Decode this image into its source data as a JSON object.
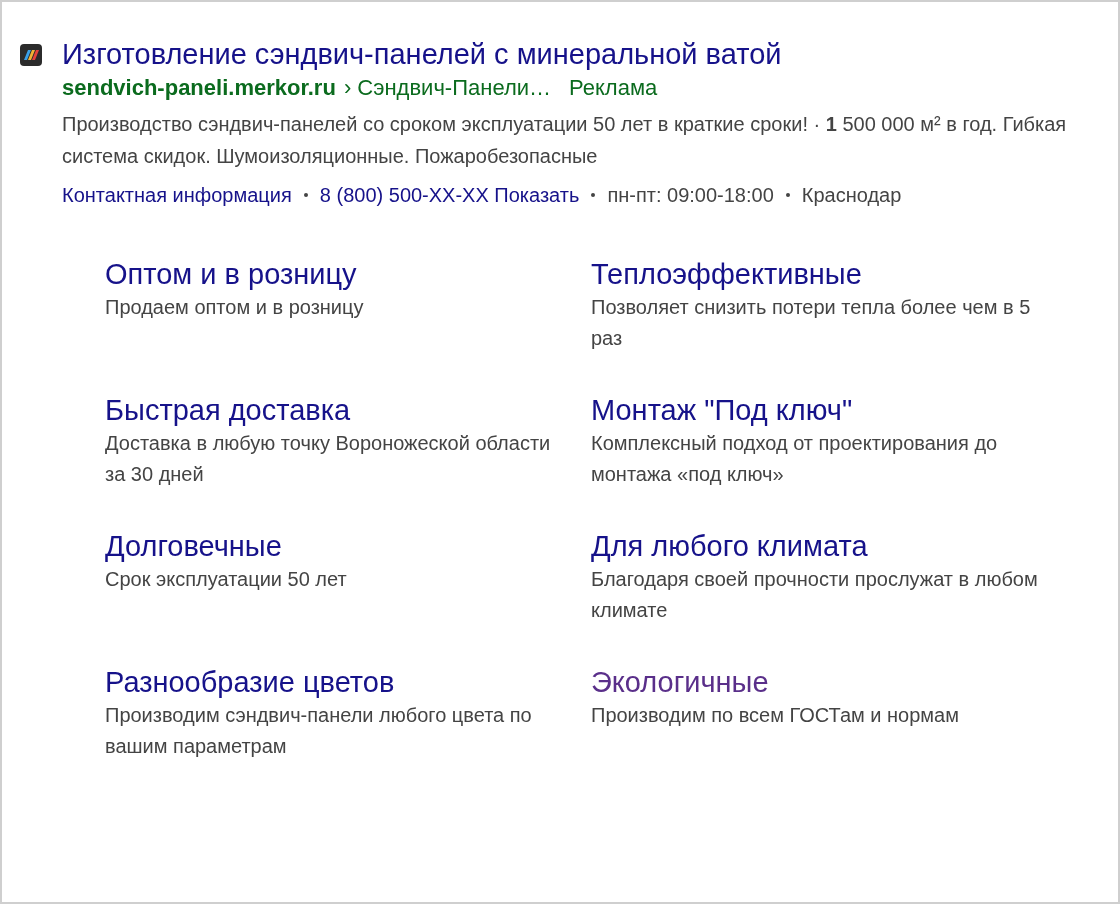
{
  "ad": {
    "title": "Изготовление сэндвич-панелей с минеральной ватой",
    "domain": "sendvich-paneli.merkor.ru",
    "path": "› Сэндвич-Панели…",
    "label": "Реклама",
    "description": "Производство сэндвич-панелей со сроком эксплуатации 50 лет в краткие сроки! · **1** 500 000 м² в год. Гибкая система скидок. Шумоизоляционные. Пожаробезопасные",
    "contacts": [
      {
        "kind": "link",
        "text": "Контактная информация"
      },
      {
        "kind": "link",
        "text": "8 (800) 500-XX-XX Показать"
      },
      {
        "kind": "text",
        "text": "пн-пт: 09:00-18:00"
      },
      {
        "kind": "text",
        "text": "Краснодар"
      }
    ]
  },
  "sitelinks": [
    {
      "title": "Оптом и в розницу",
      "text": "Продаем оптом и в розницу",
      "visited": false
    },
    {
      "title": "Теплоэффективные",
      "text": "Позволяет снизить потери тепла более чем в 5 раз",
      "visited": false
    },
    {
      "title": "Быстрая доставка",
      "text": "Доставка в любую точку Вороножеской области за 30 дней",
      "visited": false
    },
    {
      "title": "Монтаж \"Под ключ\"",
      "text": "Комплексный подход от проектирования до монтажа «под ключ»",
      "visited": false
    },
    {
      "title": "Долговечные",
      "text": "Срок эксплуатации 50 лет",
      "visited": false
    },
    {
      "title": "Для любого климата",
      "text": "Благодаря своей прочности прослужат в любом климате",
      "visited": false
    },
    {
      "title": "Разнообразие цветов",
      "text": "Производим сэндвич-панели любого цвета по вашим параметрам",
      "visited": false
    },
    {
      "title": "Экологичные",
      "text": "Производим по всем ГОСТам и нормам",
      "visited": true
    }
  ]
}
